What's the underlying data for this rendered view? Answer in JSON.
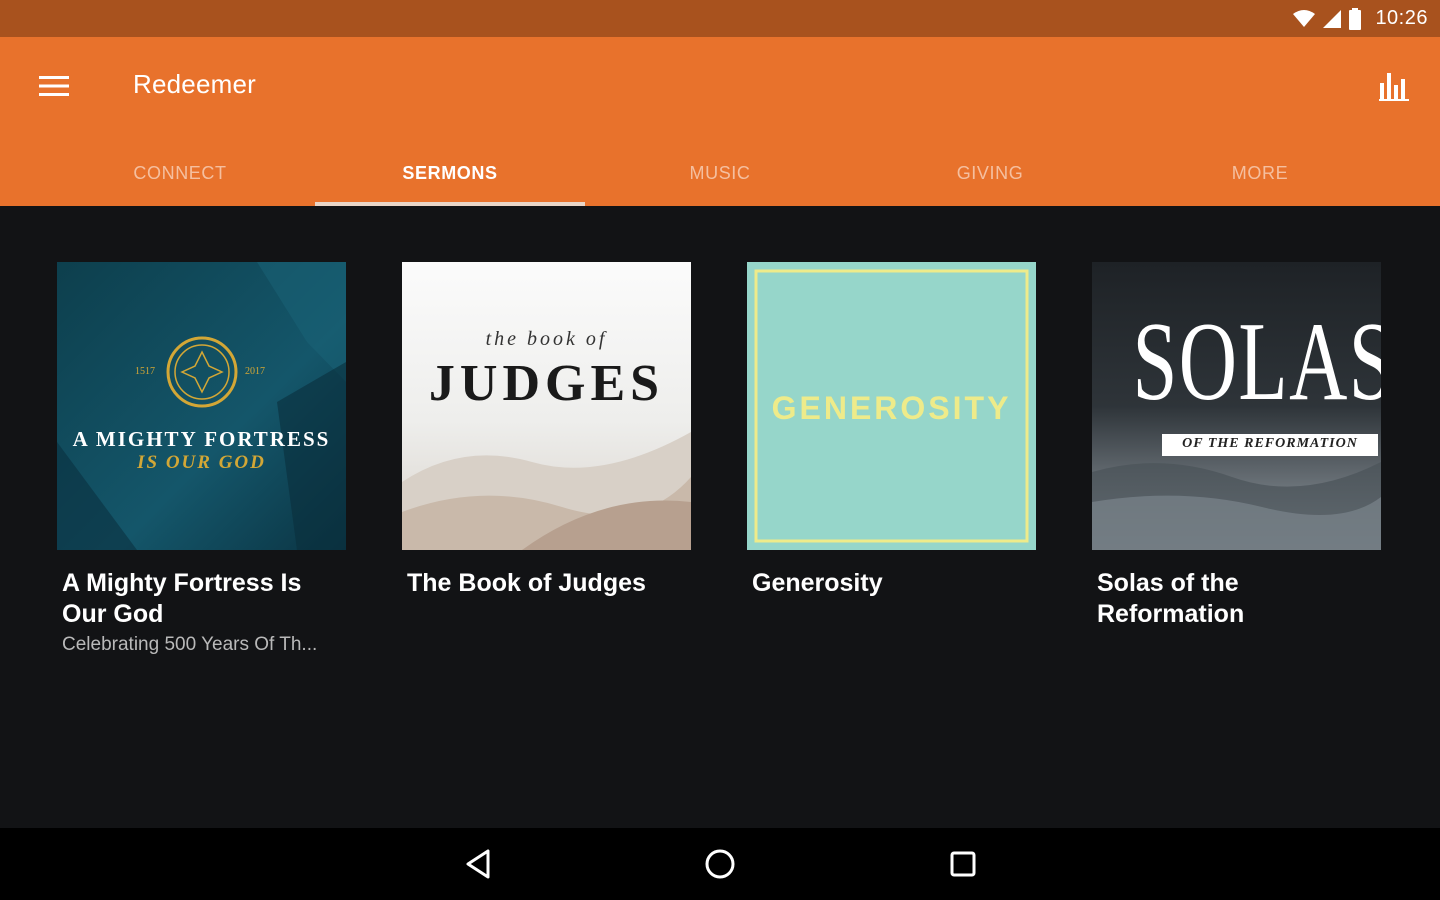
{
  "status_bar": {
    "time": "10:26"
  },
  "app_bar": {
    "title": "Redeemer"
  },
  "tabs": [
    {
      "label": "CONNECT",
      "active": false
    },
    {
      "label": "SERMONS",
      "active": true
    },
    {
      "label": "MUSIC",
      "active": false
    },
    {
      "label": "GIVING",
      "active": false
    },
    {
      "label": "MORE",
      "active": false
    }
  ],
  "series": [
    {
      "title": "A Mighty Fortress Is Our God",
      "subtitle": "Celebrating 500 Years Of Th...",
      "art": {
        "line1": "A MIGHTY FORTRESS",
        "line2": "IS OUR GOD",
        "year_left": "1517",
        "year_right": "2017"
      }
    },
    {
      "title": "The Book of Judges",
      "subtitle": "",
      "art": {
        "line1": "the book of",
        "line2": "JUDGES"
      }
    },
    {
      "title": "Generosity",
      "subtitle": "",
      "art": {
        "line1": "GENEROSITY"
      }
    },
    {
      "title": "Solas of the Reformation",
      "subtitle": "",
      "art": {
        "line1": "SOLAS",
        "line2": "OF THE REFORMATION"
      }
    }
  ],
  "colors": {
    "status_bar": "#a8521e",
    "app_bar": "#e8722c",
    "background": "#121315",
    "nav_bar": "#000000"
  }
}
